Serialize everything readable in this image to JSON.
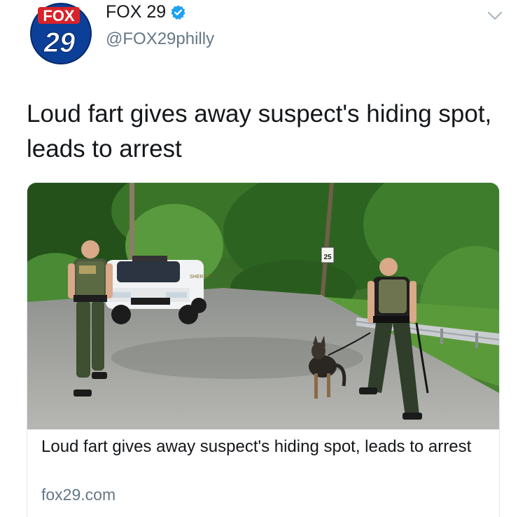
{
  "author": {
    "name": "FOX 29",
    "handle": "@FOX29philly",
    "verified": true,
    "avatar_icon": "fox29-logo",
    "avatar_text_top": "FOX",
    "avatar_text_bottom": "29"
  },
  "tweet": {
    "text": "Loud fart gives away suspect's hiding spot, leads to arrest"
  },
  "card": {
    "image_icon": "police-officers-k9-photo",
    "vehicle_text": "SHERIFF",
    "speed_sign_text": "25",
    "title": "Loud fart gives away suspect's hiding spot, leads to arrest",
    "domain": "fox29.com"
  },
  "colors": {
    "text_primary": "#14171a",
    "text_secondary": "#657786",
    "verified_blue": "#1da1f2",
    "fox_red": "#d8232a",
    "fox_blue": "#0a3a8c",
    "card_border": "#e1e8ed"
  }
}
